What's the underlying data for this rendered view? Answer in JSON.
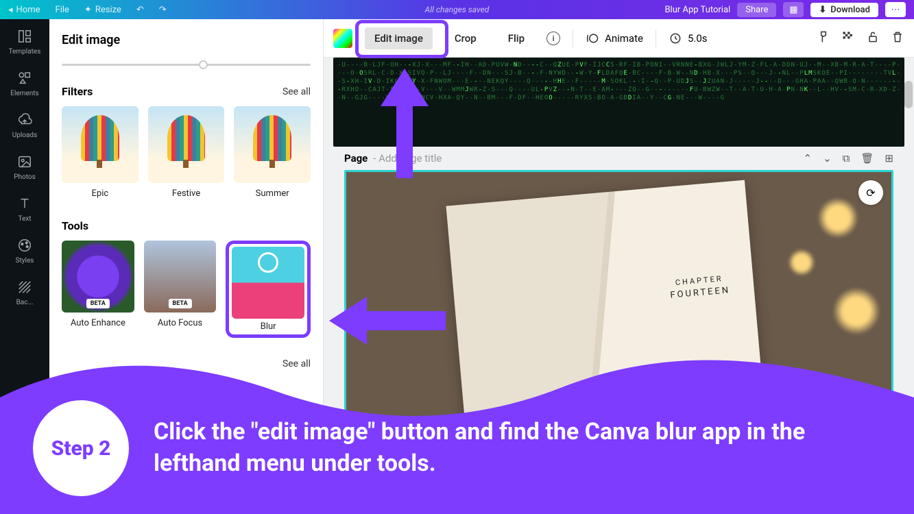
{
  "topbar": {
    "home": "Home",
    "file": "File",
    "resize": "Resize",
    "status": "All changes saved",
    "project": "Blur App Tutorial",
    "share": "Share",
    "download": "Download"
  },
  "leftnav": {
    "templates": "Templates",
    "elements": "Elements",
    "uploads": "Uploads",
    "photos": "Photos",
    "text": "Text",
    "styles": "Styles",
    "background": "Bac..."
  },
  "panel": {
    "title": "Edit image",
    "filters_head": "Filters",
    "seeall": "See all",
    "filter1": "Epic",
    "filter2": "Festive",
    "filter3": "Summer",
    "tools_head": "Tools",
    "tool1": "Auto Enhance",
    "tool2": "Auto Focus",
    "tool3": "Blur",
    "beta": "BETA"
  },
  "contextbar": {
    "edit": "Edit image",
    "crop": "Crop",
    "flip": "Flip",
    "animate": "Animate",
    "duration": "5.0s"
  },
  "page": {
    "label": "Page",
    "addtitle": "- Add page title",
    "chapter": "CHAPTER",
    "num": "FOURTEEN"
  },
  "tutorial": {
    "step": "Step 2",
    "text": "Click the \"edit image\" button and find the Canva blur app in the lefthand menu under tools."
  }
}
